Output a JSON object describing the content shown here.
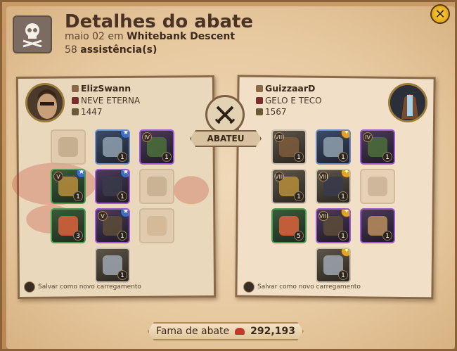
{
  "header": {
    "title": "Detalhes do abate",
    "date": "maio 02",
    "em": "em",
    "location": "Whitebank Descent",
    "assist_count": "58",
    "assist_label": "assistência(s)"
  },
  "killer": {
    "name": "ElizSwann",
    "guild": "NEVE ETERNA",
    "ip": "1447",
    "loadout_label": "Salvar como novo carregamento",
    "slots": [
      {
        "key": "bag",
        "tier": "",
        "qty": "",
        "quality": "empty"
      },
      {
        "key": "head",
        "tier": "",
        "qty": "1",
        "quality": "blue",
        "star": "blue"
      },
      {
        "key": "cape",
        "tier": "IV",
        "qty": "1",
        "quality": "purple"
      },
      {
        "key": "mainhand",
        "tier": "V",
        "qty": "1",
        "quality": "green",
        "star": "blue"
      },
      {
        "key": "armor",
        "tier": "",
        "qty": "1",
        "quality": "purple",
        "star": "blue"
      },
      {
        "key": "offhand",
        "tier": "",
        "qty": "",
        "quality": "empty"
      },
      {
        "key": "potion",
        "tier": "",
        "qty": "3",
        "quality": "green"
      },
      {
        "key": "shoes",
        "tier": "V",
        "qty": "1",
        "quality": "purple",
        "star": "blue"
      },
      {
        "key": "food",
        "tier": "",
        "qty": "",
        "quality": "empty"
      },
      {
        "key": "mount",
        "tier": "",
        "qty": "1",
        "quality": "white"
      }
    ]
  },
  "victim": {
    "name": "GuizzaarD",
    "guild": "GELO E TECO",
    "ip": "1567",
    "loadout_label": "Salvar como novo carregamento",
    "slots": [
      {
        "key": "bag",
        "tier": "VIII",
        "qty": "1",
        "quality": "white"
      },
      {
        "key": "head",
        "tier": "",
        "qty": "1",
        "quality": "blue",
        "star": "gold"
      },
      {
        "key": "cape",
        "tier": "IV",
        "qty": "1",
        "quality": "purple"
      },
      {
        "key": "mainhand",
        "tier": "VIII",
        "qty": "1",
        "quality": "white"
      },
      {
        "key": "armor",
        "tier": "VIII",
        "qty": "1",
        "quality": "white",
        "star": "gold"
      },
      {
        "key": "offhand",
        "tier": "",
        "qty": "",
        "quality": "empty"
      },
      {
        "key": "potion",
        "tier": "",
        "qty": "5",
        "quality": "green"
      },
      {
        "key": "shoes",
        "tier": "VIII",
        "qty": "1",
        "quality": "purple",
        "star": "gold"
      },
      {
        "key": "food",
        "tier": "",
        "qty": "1",
        "quality": "purple"
      },
      {
        "key": "mount",
        "tier": "",
        "qty": "1",
        "quality": "white",
        "star": "gold"
      }
    ]
  },
  "kill_label": "ABATEU",
  "fame": {
    "label": "Fama de abate",
    "value": "292,193"
  },
  "colors": {
    "fame_icon": "#c0392b",
    "close_button": "#e2a817"
  }
}
